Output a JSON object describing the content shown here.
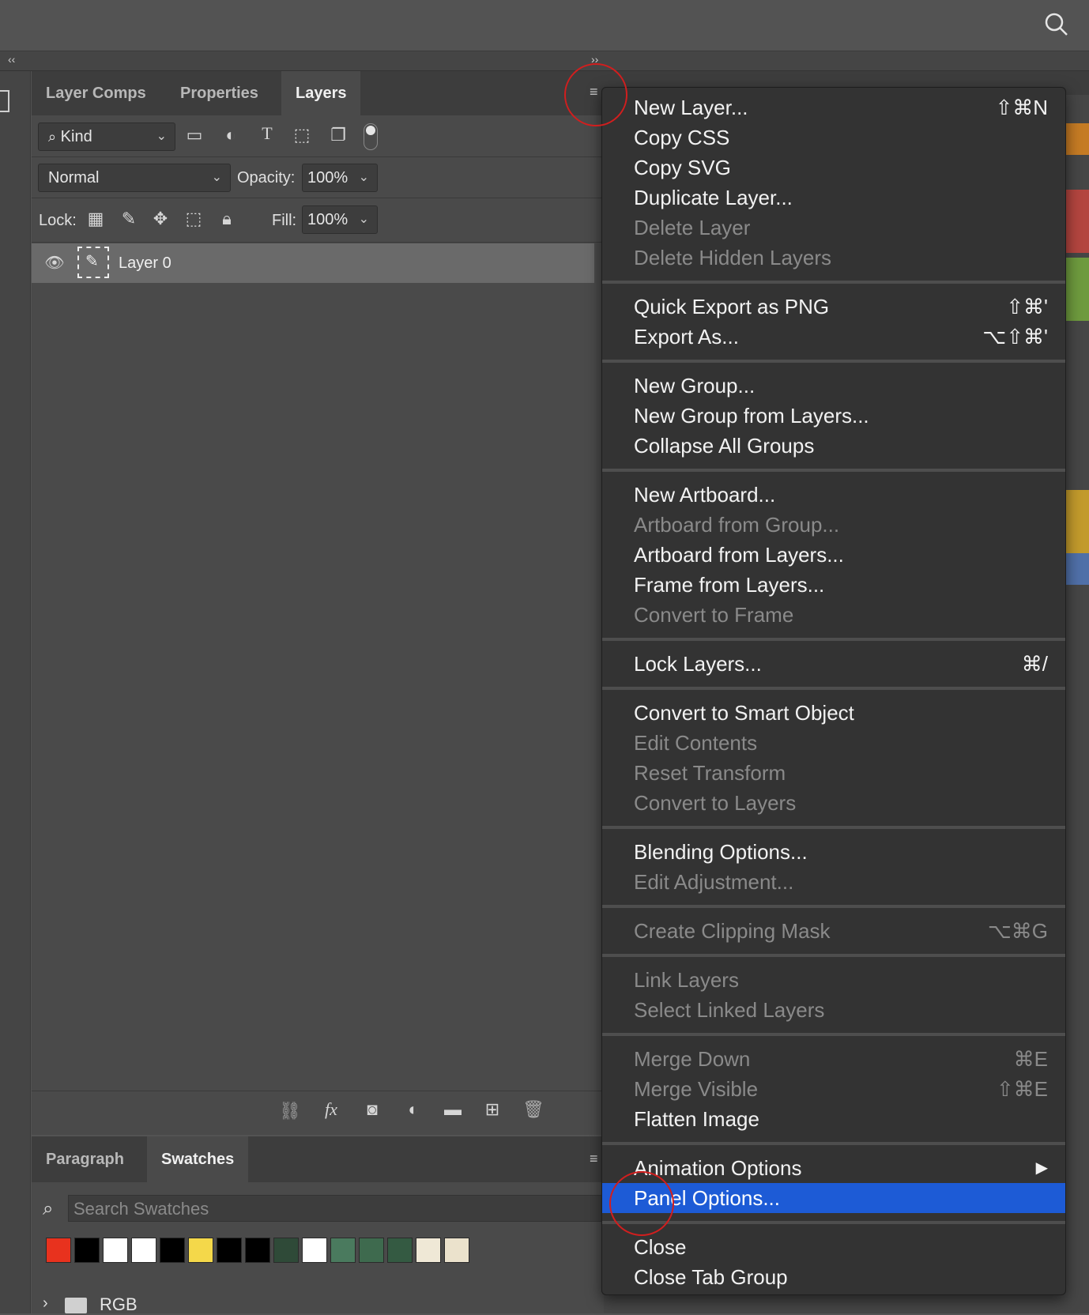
{
  "topbar": {
    "search_icon": "search-icon"
  },
  "layers_panel": {
    "tabs": [
      {
        "label": "Layer Comps",
        "active": false
      },
      {
        "label": "Properties",
        "active": false
      },
      {
        "label": "Layers",
        "active": true
      }
    ],
    "filter_kind": "Kind",
    "blend_mode": "Normal",
    "opacity_label": "Opacity:",
    "opacity_value": "100%",
    "lock_label": "Lock:",
    "fill_label": "Fill:",
    "fill_value": "100%",
    "layer_name": "Layer 0"
  },
  "swatches_panel": {
    "tabs": [
      {
        "label": "Paragraph",
        "active": false
      },
      {
        "label": "Swatches",
        "active": true
      }
    ],
    "search_placeholder": "Search Swatches",
    "swatch_colors": [
      "#e8321e",
      "#000000",
      "#ffffff",
      "#ffffff",
      "#000000",
      "#f4d84a",
      "#000000",
      "#000000",
      "#2f4a38",
      "#ffffff",
      "#4a7a5e",
      "#3e6a4e",
      "#345a42",
      "#efe8d6",
      "#ebe2cc"
    ],
    "group_name": "RGB"
  },
  "menu": {
    "items": [
      {
        "label": "New Layer...",
        "shortcut": "⇧⌘N",
        "disabled": false
      },
      {
        "label": "Copy CSS",
        "shortcut": "",
        "disabled": false
      },
      {
        "label": "Copy SVG",
        "shortcut": "",
        "disabled": false
      },
      {
        "label": "Duplicate Layer...",
        "shortcut": "",
        "disabled": false
      },
      {
        "label": "Delete Layer",
        "shortcut": "",
        "disabled": true
      },
      {
        "label": "Delete Hidden Layers",
        "shortcut": "",
        "disabled": true
      },
      {
        "label": "Quick Export as PNG",
        "shortcut": "⇧⌘'",
        "disabled": false
      },
      {
        "label": "Export As...",
        "shortcut": "⌥⇧⌘'",
        "disabled": false
      },
      {
        "label": "New Group...",
        "shortcut": "",
        "disabled": false
      },
      {
        "label": "New Group from Layers...",
        "shortcut": "",
        "disabled": false
      },
      {
        "label": "Collapse All Groups",
        "shortcut": "",
        "disabled": false
      },
      {
        "label": "New Artboard...",
        "shortcut": "",
        "disabled": false
      },
      {
        "label": "Artboard from Group...",
        "shortcut": "",
        "disabled": true
      },
      {
        "label": "Artboard from Layers...",
        "shortcut": "",
        "disabled": false
      },
      {
        "label": "Frame from Layers...",
        "shortcut": "",
        "disabled": false
      },
      {
        "label": "Convert to Frame",
        "shortcut": "",
        "disabled": true
      },
      {
        "label": "Lock Layers...",
        "shortcut": "⌘/",
        "disabled": false
      },
      {
        "label": "Convert to Smart Object",
        "shortcut": "",
        "disabled": false
      },
      {
        "label": "Edit Contents",
        "shortcut": "",
        "disabled": true
      },
      {
        "label": "Reset Transform",
        "shortcut": "",
        "disabled": true
      },
      {
        "label": "Convert to Layers",
        "shortcut": "",
        "disabled": true
      },
      {
        "label": "Blending Options...",
        "shortcut": "",
        "disabled": false
      },
      {
        "label": "Edit Adjustment...",
        "shortcut": "",
        "disabled": true
      },
      {
        "label": "Create Clipping Mask",
        "shortcut": "⌥⌘G",
        "disabled": true
      },
      {
        "label": "Link Layers",
        "shortcut": "",
        "disabled": true
      },
      {
        "label": "Select Linked Layers",
        "shortcut": "",
        "disabled": true
      },
      {
        "label": "Merge Down",
        "shortcut": "⌘E",
        "disabled": true
      },
      {
        "label": "Merge Visible",
        "shortcut": "⇧⌘E",
        "disabled": true
      },
      {
        "label": "Flatten Image",
        "shortcut": "",
        "disabled": false
      },
      {
        "label": "Animation Options",
        "shortcut": "▶",
        "disabled": false
      },
      {
        "label": "Panel Options...",
        "shortcut": "",
        "disabled": false,
        "highlighted": true
      },
      {
        "label": "Close",
        "shortcut": "",
        "disabled": false
      },
      {
        "label": "Close Tab Group",
        "shortcut": "",
        "disabled": false
      }
    ]
  },
  "colors": {
    "highlight": "#1d5bd6",
    "annotation_ring": "#d21e1e"
  }
}
